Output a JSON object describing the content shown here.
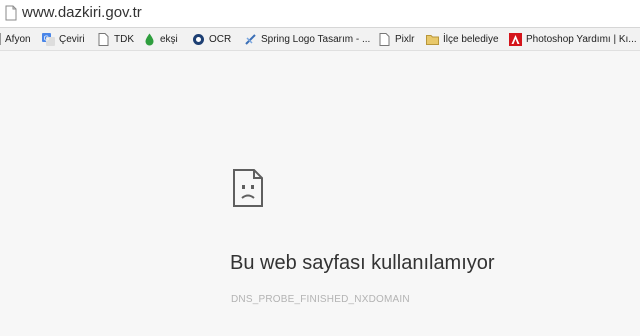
{
  "address_bar": {
    "url": "www.dazkiri.gov.tr",
    "icon": "page-icon"
  },
  "bookmarks": [
    {
      "label": "Afyon",
      "icon": "none"
    },
    {
      "label": "Çeviri",
      "icon": "translate-icon"
    },
    {
      "label": "TDK",
      "icon": "page-icon"
    },
    {
      "label": "ekşi",
      "icon": "drop-icon"
    },
    {
      "label": "OCR",
      "icon": "ocr-icon"
    },
    {
      "label": "Spring Logo Tasarım - ...",
      "icon": "spring-icon"
    },
    {
      "label": "Pixlr",
      "icon": "page-icon"
    },
    {
      "label": "İlçe belediye",
      "icon": "folder-icon"
    },
    {
      "label": "Photoshop Yardımı | Kı...",
      "icon": "adobe-icon"
    }
  ],
  "error": {
    "icon": "sad-page-icon",
    "title": "Bu web sayfası kullanılamıyor",
    "code": "DNS_PROBE_FINISHED_NXDOMAIN"
  },
  "colors": {
    "page_background": "#f7f7f7",
    "title_text": "#333333",
    "code_text": "#b3b3b3",
    "drop_green": "#2e9e3e",
    "adobe_red": "#d4141b",
    "translate_blue": "#4a86e8",
    "folder_yellow": "#e8c86a"
  }
}
